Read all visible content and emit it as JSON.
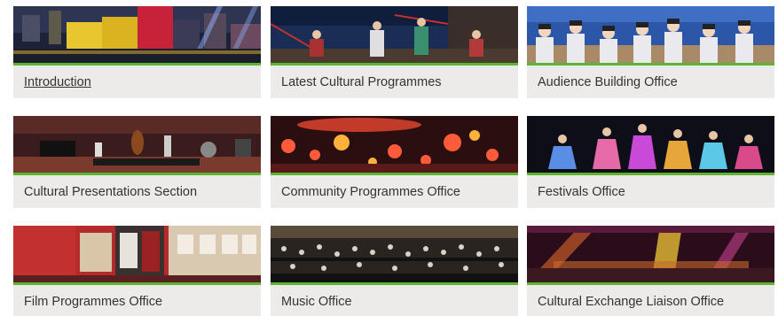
{
  "cards": [
    {
      "label": "Introduction",
      "image": "harbour-night-light-show-image"
    },
    {
      "label": "Latest Cultural Programmes",
      "image": "chinese-opera-performers-image"
    },
    {
      "label": "Audience Building Office",
      "image": "children-audience-image"
    },
    {
      "label": "Cultural Presentations Section",
      "image": "jazz-band-stage-image"
    },
    {
      "label": "Community Programmes Office",
      "image": "lantern-festival-image"
    },
    {
      "label": "Festivals Office",
      "image": "dancers-costume-performance-image"
    },
    {
      "label": "Film Programmes Office",
      "image": "film-exhibition-image"
    },
    {
      "label": "Music Office",
      "image": "orchestra-concert-image"
    },
    {
      "label": "Cultural Exchange Liaison Office",
      "image": "concert-stage-lights-image"
    }
  ],
  "colors": {
    "accent_bar": "#5bb531",
    "caption_bg": "#ecebea",
    "caption_text": "#333333"
  }
}
